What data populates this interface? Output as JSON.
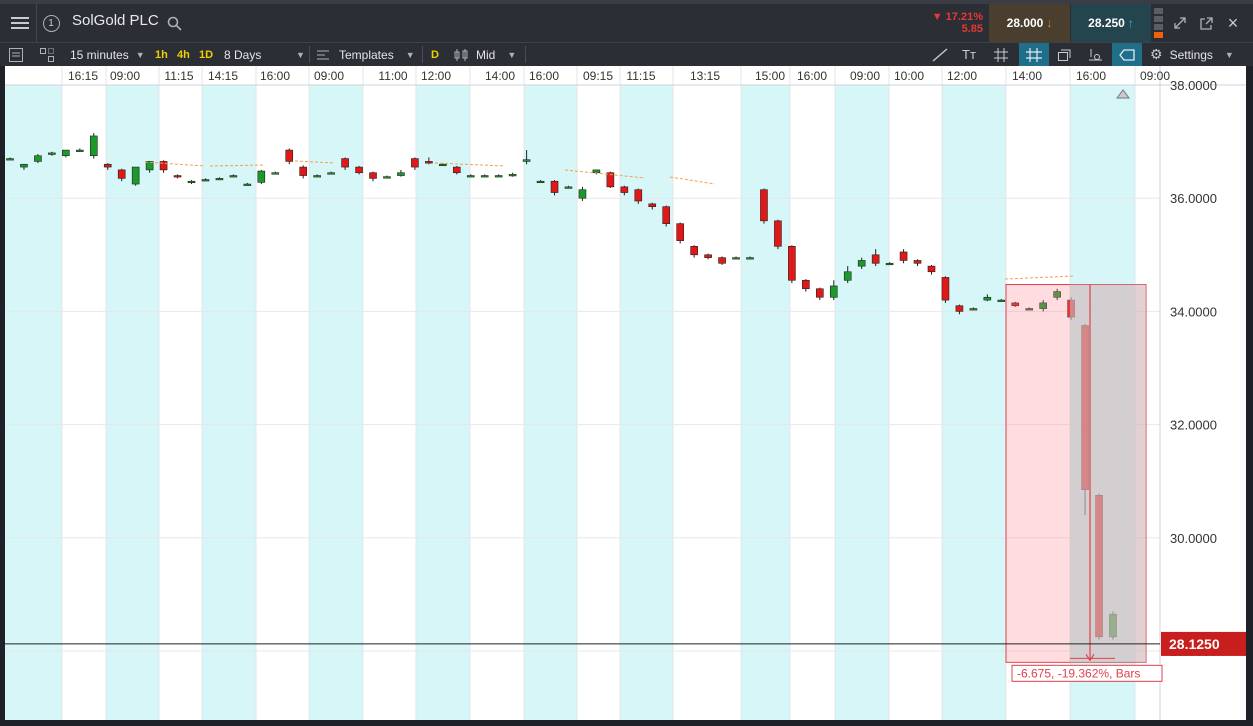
{
  "app": {
    "menu_icon": "hamburger-menu-icon",
    "link_slot": "1",
    "instrument": "SolGold PLC",
    "search_icon": "search-icon"
  },
  "quote": {
    "change_pct": "▼ 17.21%",
    "change_abs": "5.85",
    "bid": "28.000",
    "ask": "28.250",
    "colors": {
      "down": "#e53935",
      "bid_arrow": "#e0891a",
      "ask_arrow": "#27c0e8"
    }
  },
  "window_controls": {
    "expand": "expand-icon",
    "popout": "popout-icon",
    "close": "×"
  },
  "toolbar": {
    "interval": "15 minutes",
    "quick_1h": "1h",
    "quick_4h": "4h",
    "quick_1d": "1D",
    "range": "8 Days",
    "templates": "Templates",
    "d_badge": "D",
    "price_type": "Mid",
    "settings": "Settings"
  },
  "time_axis": [
    "16:15",
    "09:00",
    "11:15",
    "14:15",
    "16:00",
    "09:00",
    "11:00",
    "12:00",
    "14:00",
    "16:00",
    "09:15",
    "11:15",
    "13:15",
    "15:00",
    "16:00",
    "09:00",
    "10:00",
    "12:00",
    "14:00",
    "16:00",
    "09:00"
  ],
  "price_axis": [
    "38.0000",
    "36.0000",
    "34.0000",
    "32.0000",
    "30.0000",
    "28.0000"
  ],
  "last_price": "28.1250",
  "measure_label": "-6.675, -19.362%, Bars",
  "chart_data": {
    "type": "candlestick",
    "title": "SolGold PLC",
    "ylim": [
      27.0,
      38.0
    ],
    "yticks": [
      38,
      36,
      34,
      32,
      30,
      28
    ],
    "last_price": 28.125,
    "candles": [
      {
        "o": 36.7,
        "h": 36.72,
        "c": 36.7,
        "l": 36.68
      },
      {
        "o": 36.55,
        "h": 36.6,
        "c": 36.6,
        "l": 36.5
      },
      {
        "o": 36.65,
        "h": 36.78,
        "c": 36.75,
        "l": 36.62
      },
      {
        "o": 36.78,
        "h": 36.82,
        "c": 36.8,
        "l": 36.75
      },
      {
        "o": 36.75,
        "h": 36.85,
        "c": 36.85,
        "l": 36.72
      },
      {
        "o": 36.85,
        "h": 36.88,
        "c": 36.85,
        "l": 36.82
      },
      {
        "o": 36.75,
        "h": 37.15,
        "c": 37.1,
        "l": 36.7
      },
      {
        "o": 36.6,
        "h": 36.62,
        "c": 36.55,
        "l": 36.5
      },
      {
        "o": 36.5,
        "h": 36.52,
        "c": 36.35,
        "l": 36.3
      },
      {
        "o": 36.25,
        "h": 36.55,
        "c": 36.55,
        "l": 36.22
      },
      {
        "o": 36.5,
        "h": 36.65,
        "c": 36.65,
        "l": 36.45
      },
      {
        "o": 36.65,
        "h": 36.67,
        "c": 36.5,
        "l": 36.45
      },
      {
        "o": 36.4,
        "h": 36.42,
        "c": 36.38,
        "l": 36.35
      },
      {
        "o": 36.3,
        "h": 36.32,
        "c": 36.3,
        "l": 36.25
      },
      {
        "o": 36.32,
        "h": 36.35,
        "c": 36.33,
        "l": 36.3
      },
      {
        "o": 36.35,
        "h": 36.37,
        "c": 36.35,
        "l": 36.33
      },
      {
        "o": 36.4,
        "h": 36.42,
        "c": 36.4,
        "l": 36.38
      },
      {
        "o": 36.25,
        "h": 36.27,
        "c": 36.25,
        "l": 36.23
      },
      {
        "o": 36.28,
        "h": 36.5,
        "c": 36.48,
        "l": 36.25
      },
      {
        "o": 36.45,
        "h": 36.47,
        "c": 36.45,
        "l": 36.43
      },
      {
        "o": 36.85,
        "h": 36.88,
        "c": 36.65,
        "l": 36.6
      },
      {
        "o": 36.55,
        "h": 36.58,
        "c": 36.4,
        "l": 36.35
      },
      {
        "o": 36.4,
        "h": 36.42,
        "c": 36.4,
        "l": 36.38
      },
      {
        "o": 36.45,
        "h": 36.47,
        "c": 36.45,
        "l": 36.43
      },
      {
        "o": 36.7,
        "h": 36.72,
        "c": 36.55,
        "l": 36.5
      },
      {
        "o": 36.55,
        "h": 36.57,
        "c": 36.45,
        "l": 36.42
      },
      {
        "o": 36.45,
        "h": 36.47,
        "c": 36.35,
        "l": 36.3
      },
      {
        "o": 36.38,
        "h": 36.4,
        "c": 36.38,
        "l": 36.35
      },
      {
        "o": 36.4,
        "h": 36.5,
        "c": 36.45,
        "l": 36.38
      },
      {
        "o": 36.7,
        "h": 36.72,
        "c": 36.55,
        "l": 36.5
      },
      {
        "o": 36.65,
        "h": 36.72,
        "c": 36.62,
        "l": 36.6
      },
      {
        "o": 36.6,
        "h": 36.62,
        "c": 36.6,
        "l": 36.58
      },
      {
        "o": 36.55,
        "h": 36.57,
        "c": 36.45,
        "l": 36.42
      },
      {
        "o": 36.4,
        "h": 36.42,
        "c": 36.4,
        "l": 36.38
      },
      {
        "o": 36.4,
        "h": 36.42,
        "c": 36.4,
        "l": 36.38
      },
      {
        "o": 36.4,
        "h": 36.42,
        "c": 36.4,
        "l": 36.38
      },
      {
        "o": 36.4,
        "h": 36.45,
        "c": 36.42,
        "l": 36.38
      },
      {
        "o": 36.65,
        "h": 36.85,
        "c": 36.68,
        "l": 36.6
      },
      {
        "o": 36.3,
        "h": 36.32,
        "c": 36.3,
        "l": 36.28
      },
      {
        "o": 36.3,
        "h": 36.32,
        "c": 36.1,
        "l": 36.05
      },
      {
        "o": 36.2,
        "h": 36.22,
        "c": 36.2,
        "l": 36.18
      },
      {
        "o": 36.0,
        "h": 36.2,
        "c": 36.15,
        "l": 35.95
      },
      {
        "o": 36.45,
        "h": 36.5,
        "c": 36.5,
        "l": 36.42
      },
      {
        "o": 36.45,
        "h": 36.47,
        "c": 36.2,
        "l": 36.18
      },
      {
        "o": 36.2,
        "h": 36.22,
        "c": 36.1,
        "l": 36.05
      },
      {
        "o": 36.15,
        "h": 36.17,
        "c": 35.95,
        "l": 35.9
      },
      {
        "o": 35.9,
        "h": 35.92,
        "c": 35.85,
        "l": 35.8
      },
      {
        "o": 35.85,
        "h": 35.87,
        "c": 35.55,
        "l": 35.5
      },
      {
        "o": 35.55,
        "h": 35.57,
        "c": 35.25,
        "l": 35.2
      },
      {
        "o": 35.15,
        "h": 35.17,
        "c": 35.0,
        "l": 34.95
      },
      {
        "o": 35.0,
        "h": 35.02,
        "c": 34.95,
        "l": 34.92
      },
      {
        "o": 34.95,
        "h": 34.97,
        "c": 34.85,
        "l": 34.82
      },
      {
        "o": 34.95,
        "h": 34.97,
        "c": 34.95,
        "l": 34.93
      },
      {
        "o": 34.95,
        "h": 34.97,
        "c": 34.95,
        "l": 34.93
      },
      {
        "o": 36.15,
        "h": 36.17,
        "c": 35.6,
        "l": 35.55
      },
      {
        "o": 35.6,
        "h": 35.62,
        "c": 35.15,
        "l": 35.1
      },
      {
        "o": 35.15,
        "h": 35.17,
        "c": 34.55,
        "l": 34.5
      },
      {
        "o": 34.55,
        "h": 34.57,
        "c": 34.4,
        "l": 34.35
      },
      {
        "o": 34.4,
        "h": 34.42,
        "c": 34.25,
        "l": 34.2
      },
      {
        "o": 34.25,
        "h": 34.55,
        "c": 34.45,
        "l": 34.2
      },
      {
        "o": 34.55,
        "h": 34.8,
        "c": 34.7,
        "l": 34.5
      },
      {
        "o": 34.8,
        "h": 34.95,
        "c": 34.9,
        "l": 34.75
      },
      {
        "o": 35.0,
        "h": 35.1,
        "c": 34.85,
        "l": 34.8
      },
      {
        "o": 34.85,
        "h": 34.87,
        "c": 34.85,
        "l": 34.83
      },
      {
        "o": 35.05,
        "h": 35.1,
        "c": 34.9,
        "l": 34.85
      },
      {
        "o": 34.9,
        "h": 34.92,
        "c": 34.85,
        "l": 34.8
      },
      {
        "o": 34.8,
        "h": 34.82,
        "c": 34.7,
        "l": 34.65
      },
      {
        "o": 34.6,
        "h": 34.62,
        "c": 34.2,
        "l": 34.15
      },
      {
        "o": 34.1,
        "h": 34.12,
        "c": 34.0,
        "l": 33.95
      },
      {
        "o": 34.05,
        "h": 34.07,
        "c": 34.05,
        "l": 34.03
      },
      {
        "o": 34.2,
        "h": 34.3,
        "c": 34.25,
        "l": 34.18
      },
      {
        "o": 34.2,
        "h": 34.22,
        "c": 34.2,
        "l": 34.18
      },
      {
        "o": 34.15,
        "h": 34.17,
        "c": 34.1,
        "l": 34.08
      },
      {
        "o": 34.05,
        "h": 34.07,
        "c": 34.05,
        "l": 34.03
      },
      {
        "o": 34.05,
        "h": 34.2,
        "c": 34.15,
        "l": 34.0
      },
      {
        "o": 34.25,
        "h": 34.4,
        "c": 34.35,
        "l": 34.2
      },
      {
        "o": 34.2,
        "h": 34.25,
        "c": 33.9,
        "l": 33.85
      },
      {
        "o": 33.75,
        "h": 33.78,
        "c": 30.85,
        "l": 30.4
      },
      {
        "o": 30.75,
        "h": 30.78,
        "c": 28.25,
        "l": 28.2
      },
      {
        "o": 28.25,
        "h": 28.7,
        "c": 28.65,
        "l": 28.2
      }
    ],
    "annotation": {
      "label": "-6.675, -19.362%, Bars",
      "from_price": 34.475,
      "to_price": 27.8
    }
  }
}
